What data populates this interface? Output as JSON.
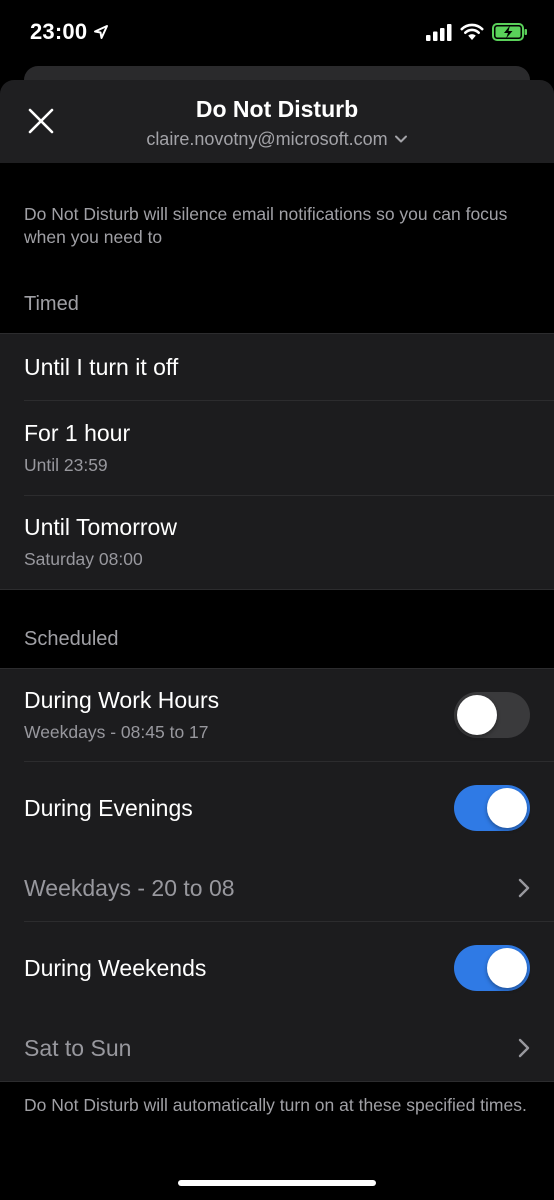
{
  "status_bar": {
    "time": "23:00"
  },
  "header": {
    "title": "Do Not Disturb",
    "account": "claire.novotny@microsoft.com"
  },
  "intro_text": "Do Not Disturb will silence email notifications so you can focus when you need to",
  "timed": {
    "section_label": "Timed",
    "items": [
      {
        "title": "Until I turn it off"
      },
      {
        "title": "For 1 hour",
        "subtitle": "Until 23:59"
      },
      {
        "title": "Until Tomorrow",
        "subtitle": "Saturday 08:00"
      }
    ]
  },
  "scheduled": {
    "section_label": "Scheduled",
    "work_hours": {
      "title": "During Work Hours",
      "subtitle": "Weekdays - 08:45 to 17",
      "enabled": false
    },
    "evenings": {
      "title": "During Evenings",
      "enabled": true,
      "schedule": "Weekdays - 20 to 08"
    },
    "weekends": {
      "title": "During Weekends",
      "enabled": true,
      "schedule": "Sat to Sun"
    }
  },
  "footer_text": "Do Not Disturb will automatically turn on at these specified times.",
  "colors": {
    "accent": "#2f7ae5",
    "background": "#000000",
    "surface": "#1c1c1e",
    "header_surface": "#1f1f21",
    "secondary_text": "#a0a0a5",
    "battery_charging": "#5ad15a"
  },
  "icons": [
    "location-arrow-icon",
    "cellular-signal-icon",
    "wifi-icon",
    "battery-charging-icon",
    "close-icon",
    "chevron-down-icon",
    "chevron-right-icon"
  ]
}
